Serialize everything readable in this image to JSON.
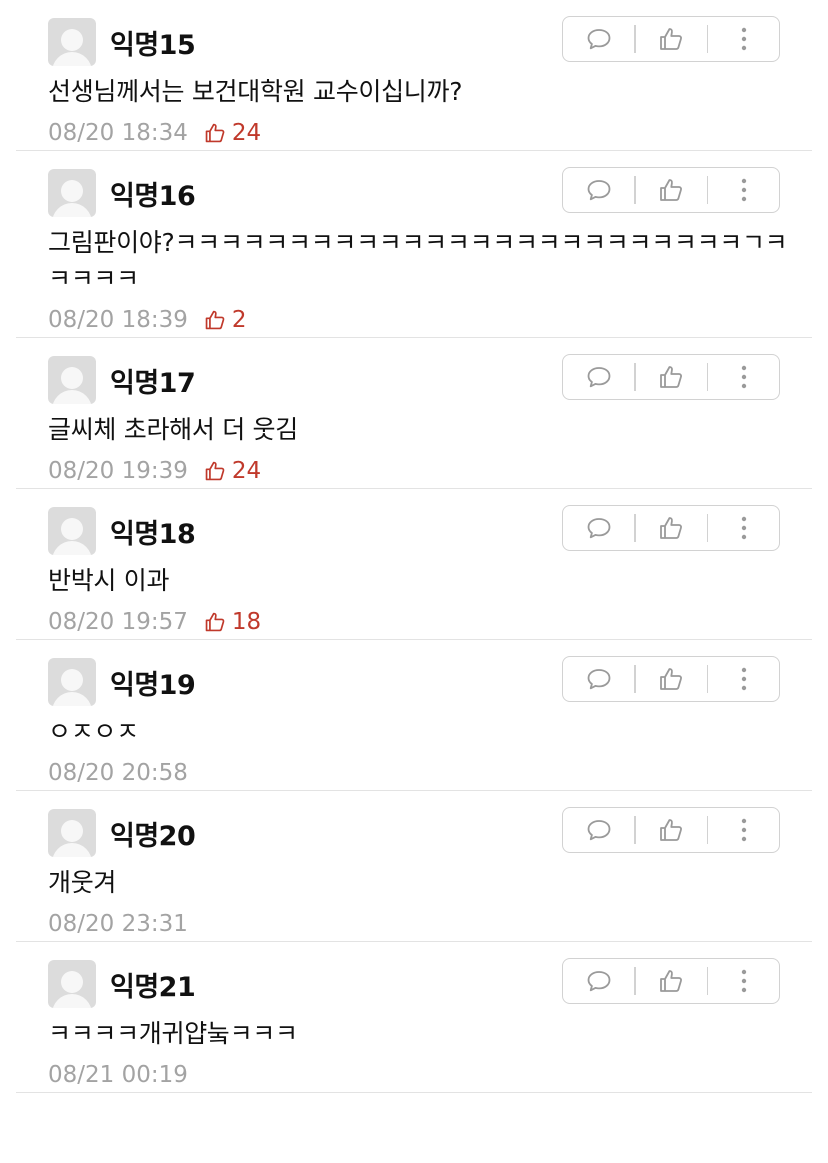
{
  "colors": {
    "like_accent": "#c0392b",
    "meta_gray": "#a3a3a3",
    "divider": "#e3e3e3"
  },
  "comments": [
    {
      "author": "익명15",
      "text": "선생님께서는 보건대학원 교수이십니까?",
      "time": "08/20 18:34",
      "likes": "24"
    },
    {
      "author": "익명16",
      "text": "그림판이야?ㅋㅋㅋㅋㅋㅋㅋㅋㅋㅋㅋㅋㅋㅋㅋㅋㅋㅋㅋㅋㅋㅋㅋㅋㅋㄱㅋ\nㅋㅋㅋㅋ",
      "time": "08/20 18:39",
      "likes": "2"
    },
    {
      "author": "익명17",
      "text": "글씨체 초라해서 더 웃김",
      "time": "08/20 19:39",
      "likes": "24"
    },
    {
      "author": "익명18",
      "text": "반박시 이과",
      "time": "08/20 19:57",
      "likes": "18"
    },
    {
      "author": "익명19",
      "text": "ㅇㅈㅇㅈ",
      "time": "08/20 20:58",
      "likes": null
    },
    {
      "author": "익명20",
      "text": "개웃겨",
      "time": "08/20 23:31",
      "likes": null
    },
    {
      "author": "익명21",
      "text": "ㅋㅋㅋㅋ개귀얍눜ㅋㅋㅋ",
      "time": "08/21 00:19",
      "likes": null
    }
  ],
  "icons": {
    "reply": "speech-bubble-icon",
    "like": "thumbs-up-icon",
    "more": "vertical-dots-icon"
  }
}
